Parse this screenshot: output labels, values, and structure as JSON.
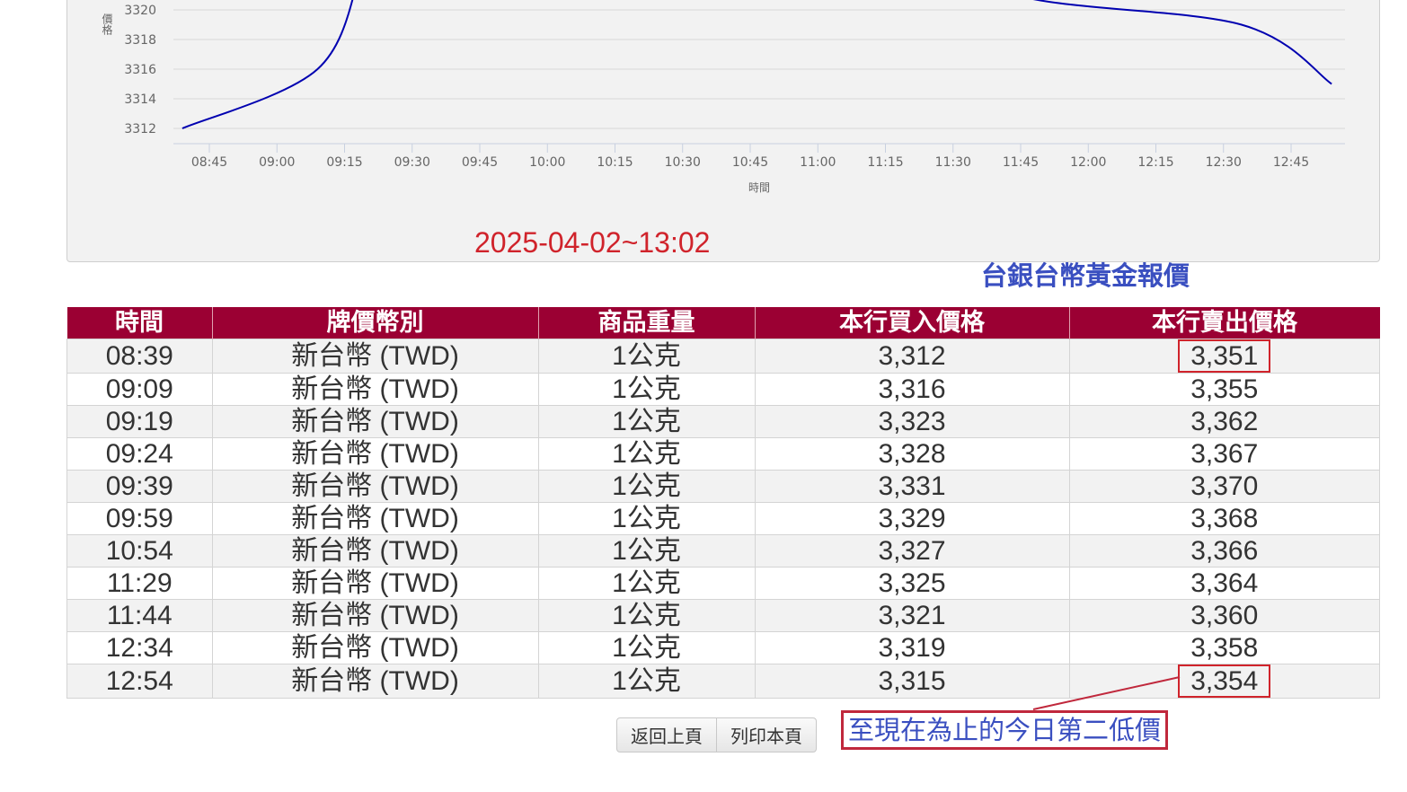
{
  "chart_data": {
    "type": "line",
    "ylabel": "價格",
    "xlabel": "時間",
    "yticks": [
      3312,
      3314,
      3316,
      3318,
      3320
    ],
    "xticks": [
      "08:45",
      "09:00",
      "09:15",
      "09:30",
      "09:45",
      "10:00",
      "10:15",
      "10:30",
      "10:45",
      "11:00",
      "11:15",
      "11:30",
      "11:45",
      "12:00",
      "12:15",
      "12:30",
      "12:45"
    ],
    "series": [
      {
        "name": "本行買入價格",
        "color": "#0000b0",
        "x": [
          "08:39",
          "09:09",
          "09:19",
          "09:24",
          "09:39",
          "09:59",
          "10:54",
          "11:29",
          "11:44",
          "12:34",
          "12:54"
        ],
        "y": [
          3312,
          3316,
          3323,
          3328,
          3331,
          3329,
          3327,
          3325,
          3321,
          3319,
          3315
        ]
      }
    ]
  },
  "timestamp": "2025-04-02~13:02",
  "caption": "台銀台幣黃金報價",
  "table": {
    "headers": [
      "時間",
      "牌價幣別",
      "商品重量",
      "本行買入價格",
      "本行賣出價格"
    ],
    "rows": [
      [
        "08:39",
        "新台幣 (TWD)",
        "1公克",
        "3,312",
        "3,351"
      ],
      [
        "09:09",
        "新台幣 (TWD)",
        "1公克",
        "3,316",
        "3,355"
      ],
      [
        "09:19",
        "新台幣 (TWD)",
        "1公克",
        "3,323",
        "3,362"
      ],
      [
        "09:24",
        "新台幣 (TWD)",
        "1公克",
        "3,328",
        "3,367"
      ],
      [
        "09:39",
        "新台幣 (TWD)",
        "1公克",
        "3,331",
        "3,370"
      ],
      [
        "09:59",
        "新台幣 (TWD)",
        "1公克",
        "3,329",
        "3,368"
      ],
      [
        "10:54",
        "新台幣 (TWD)",
        "1公克",
        "3,327",
        "3,366"
      ],
      [
        "11:29",
        "新台幣 (TWD)",
        "1公克",
        "3,325",
        "3,364"
      ],
      [
        "11:44",
        "新台幣 (TWD)",
        "1公克",
        "3,321",
        "3,360"
      ],
      [
        "12:34",
        "新台幣 (TWD)",
        "1公克",
        "3,319",
        "3,358"
      ],
      [
        "12:54",
        "新台幣 (TWD)",
        "1公克",
        "3,315",
        "3,354"
      ]
    ]
  },
  "buttons": {
    "back": "返回上頁",
    "print": "列印本頁"
  },
  "annotation": "至現在為止的今日第二低價"
}
